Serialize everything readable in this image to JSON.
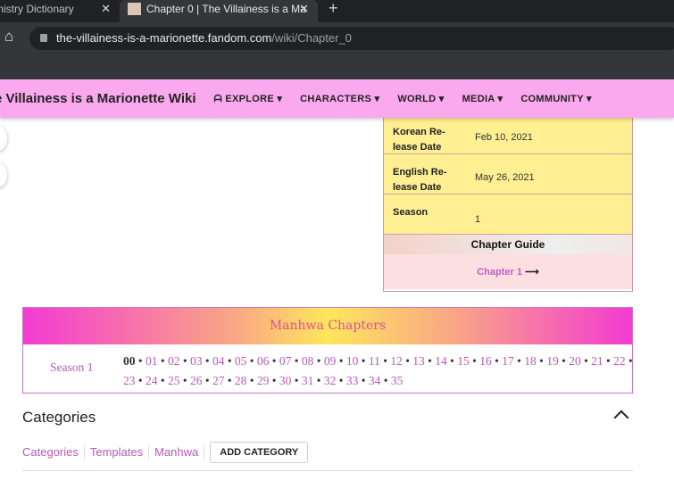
{
  "browser": {
    "tabs": [
      {
        "title": "mistry Dictionary"
      },
      {
        "title": "Chapter 0 | The Villainess is a Ma"
      }
    ],
    "close": "✕",
    "new_tab": "+",
    "home": "⌂",
    "url_host": "the-villainess-is-a-marionette.fandom.com",
    "url_path": "/wiki/Chapter_0"
  },
  "nav": {
    "wiki_name": "e Villainess is a Marionette Wiki",
    "items": [
      {
        "label": "EXPLORE ▾"
      },
      {
        "label": "CHARACTERS ▾"
      },
      {
        "label": "WORLD ▾"
      },
      {
        "label": "MEDIA ▾"
      },
      {
        "label": "COMMUNITY ▾"
      }
    ]
  },
  "infobox": {
    "rows": [
      {
        "key": "Korean Re-lease Date",
        "value": "Feb 10, 2021"
      },
      {
        "key": "English Re-lease Date",
        "value": "May 26, 2021"
      },
      {
        "key": "Season",
        "value": "1"
      }
    ],
    "guide_title": "Chapter Guide",
    "next_label": "Chapter 1",
    "next_arrow": "⟶"
  },
  "manhwa": {
    "title": "Manhwa Chapters",
    "season": "Season 1",
    "current": "00",
    "chapters": [
      "01",
      "02",
      "03",
      "04",
      "05",
      "06",
      "07",
      "08",
      "09",
      "10",
      "11",
      "12",
      "13",
      "14",
      "15",
      "16",
      "17",
      "18",
      "19",
      "20",
      "21",
      "22",
      "23",
      "24",
      "25",
      "26",
      "27",
      "28",
      "29",
      "30",
      "31",
      "32",
      "33",
      "34",
      "35"
    ]
  },
  "categories": {
    "title": "Categories",
    "links": [
      "Categories",
      "Templates",
      "Manhwa"
    ],
    "add_label": "ADD CATEGORY"
  }
}
